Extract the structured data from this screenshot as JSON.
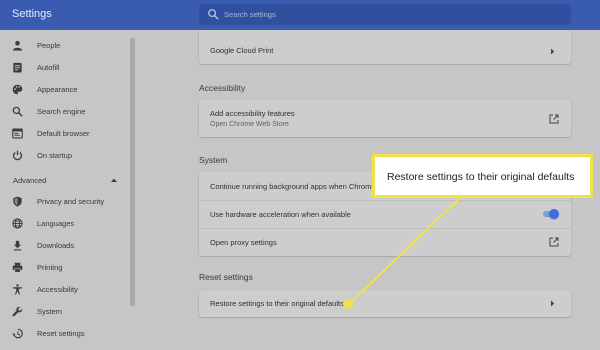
{
  "app": {
    "title": "Settings"
  },
  "search": {
    "placeholder": "Search settings"
  },
  "sidebar": {
    "items": [
      {
        "label": "People",
        "icon": "person-icon"
      },
      {
        "label": "Autofill",
        "icon": "clipboard-icon"
      },
      {
        "label": "Appearance",
        "icon": "palette-icon"
      },
      {
        "label": "Search engine",
        "icon": "search-icon"
      },
      {
        "label": "Default browser",
        "icon": "browser-window-icon"
      },
      {
        "label": "On startup",
        "icon": "power-icon"
      }
    ],
    "advanced_label": "Advanced",
    "advanced_items": [
      {
        "label": "Privacy and security",
        "icon": "shield-icon"
      },
      {
        "label": "Languages",
        "icon": "globe-icon"
      },
      {
        "label": "Downloads",
        "icon": "download-icon"
      },
      {
        "label": "Printing",
        "icon": "printer-icon"
      },
      {
        "label": "Accessibility",
        "icon": "accessibility-icon"
      },
      {
        "label": "System",
        "icon": "wrench-icon"
      },
      {
        "label": "Reset settings",
        "icon": "reset-icon"
      }
    ]
  },
  "main": {
    "printing_card": {
      "google_cloud_print": "Google Cloud Print"
    },
    "accessibility": {
      "title": "Accessibility",
      "add_features_label": "Add accessibility features",
      "add_features_sub": "Open Chrome Web Store"
    },
    "system": {
      "title": "System",
      "background_apps": "Continue running background apps when Chromium",
      "hardware_accel": "Use hardware acceleration when available",
      "hardware_accel_on": true,
      "proxy": "Open proxy settings"
    },
    "reset": {
      "title": "Reset settings",
      "restore_label": "Restore settings to their original defaults"
    }
  },
  "callout": {
    "text": "Restore settings to their original defaults",
    "border_color": "#f2e14a"
  },
  "colors": {
    "topbar": "#3a5cb0",
    "accent": "#3a6fe0"
  }
}
